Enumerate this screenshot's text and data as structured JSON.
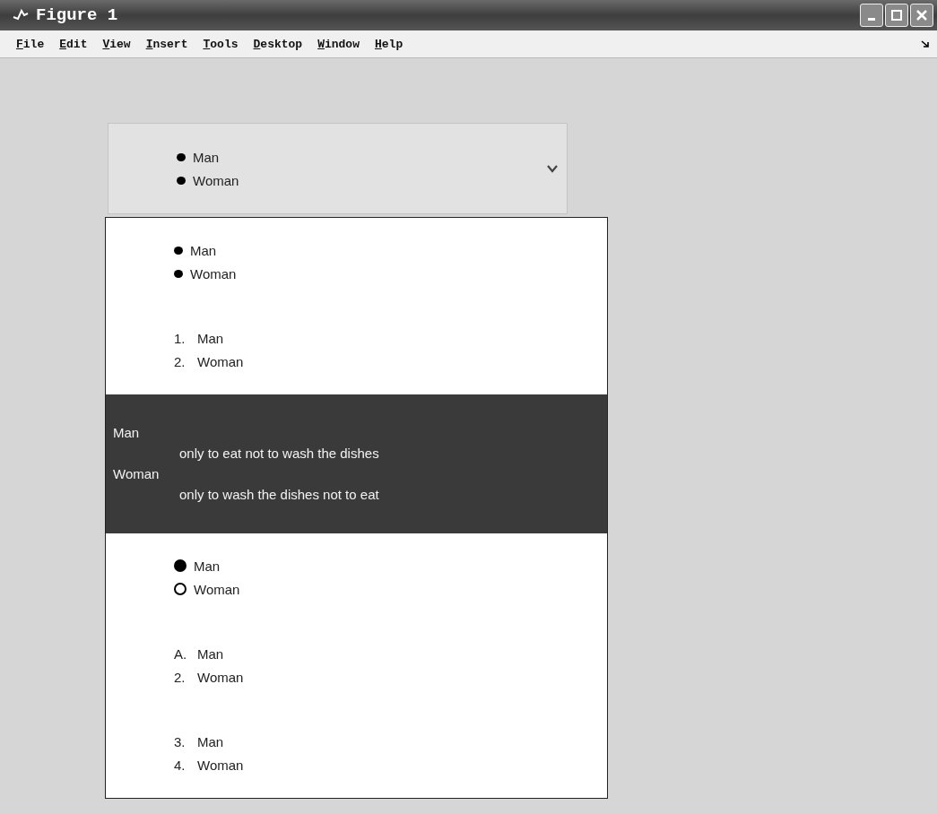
{
  "window": {
    "title": "Figure 1"
  },
  "menu": [
    {
      "label": "File"
    },
    {
      "label": "Edit"
    },
    {
      "label": "View"
    },
    {
      "label": "Insert"
    },
    {
      "label": "Tools"
    },
    {
      "label": "Desktop"
    },
    {
      "label": "Window"
    },
    {
      "label": "Help"
    }
  ],
  "popup": {
    "items": [
      "Man",
      "Woman"
    ]
  },
  "panel": {
    "sections": [
      {
        "kind": "bullets",
        "items": [
          {
            "text": "Man"
          },
          {
            "text": "Woman"
          }
        ]
      },
      {
        "kind": "numbered",
        "items": [
          {
            "marker": "1.",
            "text": "Man"
          },
          {
            "marker": "2.",
            "text": "Woman"
          }
        ]
      },
      {
        "kind": "definitions",
        "items": [
          {
            "term": "Man",
            "desc": "only to eat not to wash the dishes"
          },
          {
            "term": "Woman",
            "desc": "only to wash the dishes not to eat"
          }
        ]
      },
      {
        "kind": "radios",
        "items": [
          {
            "text": "Man",
            "selected": true
          },
          {
            "text": "Woman",
            "selected": false
          }
        ]
      },
      {
        "kind": "numbered",
        "items": [
          {
            "marker": "A.",
            "text": "Man"
          },
          {
            "marker": "2.",
            "text": "Woman"
          }
        ]
      },
      {
        "kind": "numbered",
        "items": [
          {
            "marker": "3.",
            "text": "Man"
          },
          {
            "marker": "4.",
            "text": "Woman"
          }
        ]
      }
    ]
  }
}
